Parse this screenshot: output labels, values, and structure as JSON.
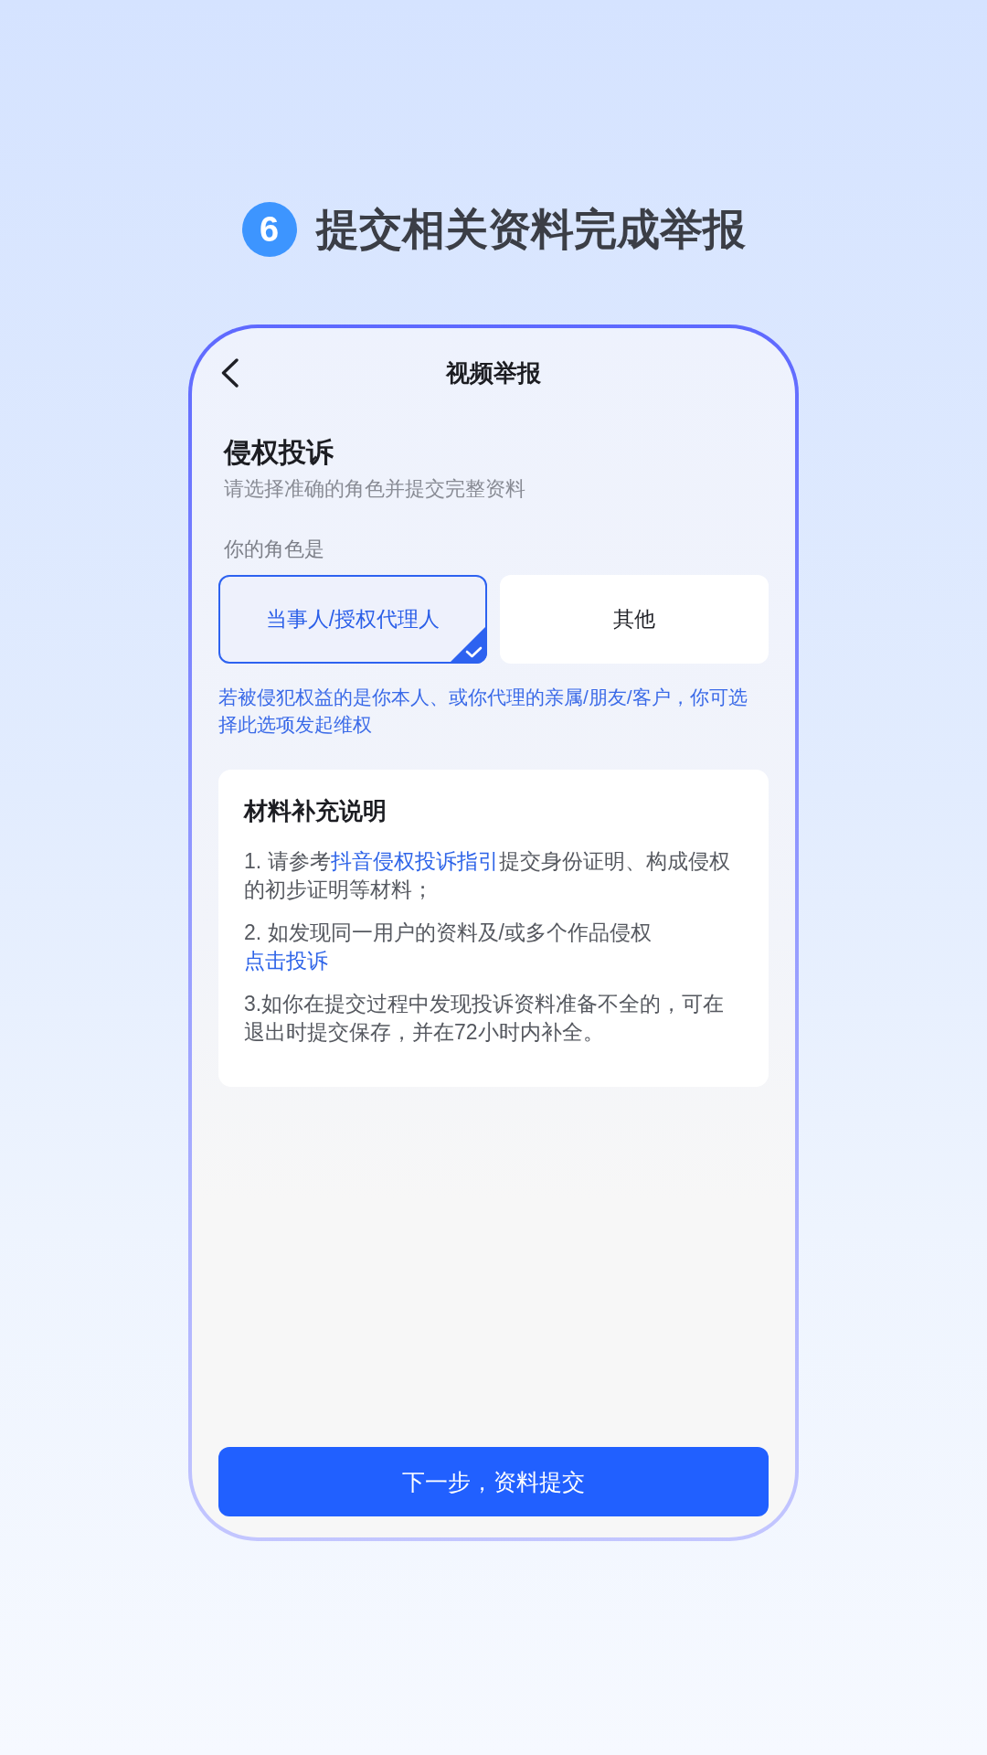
{
  "heading": {
    "step": "6",
    "title": "提交相关资料完成举报"
  },
  "phone": {
    "nav": {
      "title": "视频举报"
    },
    "section": {
      "title": "侵权投诉",
      "subtitle": "请选择准确的角色并提交完整资料"
    },
    "role": {
      "label": "你的角色是",
      "options": [
        {
          "label": "当事人/授权代理人",
          "selected": true
        },
        {
          "label": "其他",
          "selected": false
        }
      ],
      "hint": "若被侵犯权益的是你本人、或你代理的亲属/朋友/客户，你可选择此选项发起维权"
    },
    "notes": {
      "title": "材料补充说明",
      "items": [
        {
          "segments": [
            {
              "kind": "text",
              "text": "1. 请参考"
            },
            {
              "kind": "link",
              "text": "抖音侵权投诉指引"
            },
            {
              "kind": "text",
              "text": "提交身份证明、构成侵权的初步证明等材料；"
            }
          ]
        },
        {
          "segments": [
            {
              "kind": "text",
              "text": "2. 如发现同一用户的资料及/或多个作品侵权"
            },
            {
              "kind": "link",
              "text": "点击投诉"
            }
          ]
        },
        {
          "segments": [
            {
              "kind": "text",
              "text": "3.如你在提交过程中发现投诉资料准备不全的，可在退出时提交保存，并在72小时内补全。"
            }
          ]
        }
      ]
    },
    "submit_button": {
      "label": "下一步，资料提交"
    }
  }
}
